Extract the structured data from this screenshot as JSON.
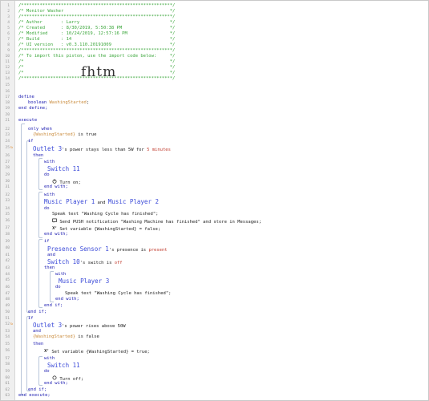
{
  "editor": {
    "header_lines": [
      "/*********************************************************/",
      "/* Monitor Washer                                        */",
      "/*********************************************************/",
      "/* Author       : Larry                                  */",
      "/* Created      : 8/30/2019, 5:50:38 PM                  */",
      "/* Modified     : 10/24/2019, 12:57:16 PM                */",
      "/* Build        : 14                                     */",
      "/* UI version   : v0.3.110.20191009                      */",
      "/*********************************************************/",
      "/* To import this piston, use the import code below:     */",
      "/*                                                       */",
      "/*                                                       */",
      "/*                                                       */",
      "/*********************************************************/"
    ],
    "import_code": "fhtm",
    "define_kw": "define",
    "boolean_kw": "boolean",
    "var_name": "WashingStarted",
    "end_define": "end define;",
    "execute_kw": "execute",
    "only_when": "only when",
    "cond_washing_true_var": "{WashingStarted}",
    "is_true": " is true",
    "if_kw": "if",
    "outlet3": "Outlet 3",
    "power_stays": "'s power stays less than 5W for ",
    "five_minutes": "5 minutes",
    "then_kw": "then",
    "with_kw": "with",
    "switch11": "Switch 11",
    "do_kw": "do",
    "turn_on": "Turn on;",
    "end_with": "end with;",
    "music_player1": "Music Player 1",
    "and_word": " and ",
    "music_player2": "Music Player 2",
    "speak_text_line": "Speak text \"Washing Cycle has finished\";",
    "send_push": "Send PUSH notification \"Washing Machine has finished\" and store in Messages;",
    "set_var_false": "Set variable {WashingStarted} = false;",
    "presence_sensor": "Presence Sensor 1",
    "presence_is": "'s presence is ",
    "present": "present",
    "and_kw": "and",
    "switch10": "Switch 10",
    "switch_is": "'s switch is ",
    "off_word": "off",
    "music_player3": "Music Player 3",
    "end_if": "end if;",
    "power_rises": "'s power rises above 50W",
    "is_false": " is false",
    "set_var_true": "Set variable {WashingStarted} = true;",
    "turn_off": "Turn off;",
    "end_execute": "end execute;",
    "line_numbers": [
      1,
      2,
      3,
      4,
      5,
      6,
      7,
      8,
      9,
      10,
      11,
      12,
      13,
      14,
      15,
      16,
      17,
      18,
      19,
      20,
      21,
      22,
      23,
      24,
      25,
      26,
      27,
      28,
      29,
      30,
      31,
      32,
      33,
      34,
      35,
      36,
      37,
      38,
      39,
      40,
      41,
      42,
      43,
      44,
      45,
      46,
      47,
      48,
      49,
      50,
      51,
      52,
      53,
      54,
      55,
      56,
      57,
      58,
      59,
      60,
      61,
      62,
      63,
      64,
      65,
      66
    ]
  },
  "colors": {
    "comment": "#3aa63a",
    "keyword": "#1a1ab0",
    "variable": "#c98a3a",
    "device": "#3b4ad8",
    "value": "#c0392b"
  }
}
